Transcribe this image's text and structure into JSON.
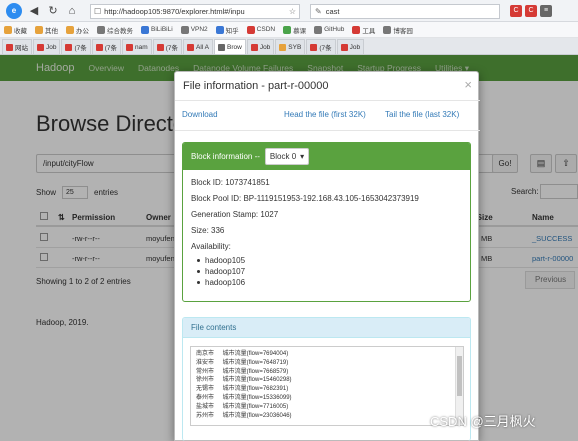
{
  "browser": {
    "url": "http://hadoop105:9870/explorer.html#/inpu",
    "search_query": "cast",
    "bookmarks": [
      "收藏",
      "其他",
      "办公",
      "综合教务",
      "BiLiBiLi",
      "VPN2",
      "知乎",
      "CSDN",
      "慕课",
      "GitHub",
      "工具",
      "博客园"
    ],
    "tabs": [
      "网站",
      "Job",
      "(7条",
      "(7条",
      "nam",
      "(7条",
      "All A",
      "Brow",
      "Job",
      "SYB",
      "(7条",
      "Job"
    ]
  },
  "hadoop": {
    "brand": "Hadoop",
    "nav": [
      "Overview",
      "Datanodes",
      "Datanode Volume Failures",
      "Snapshot",
      "Startup Progress",
      "Utilities ▾"
    ],
    "page_title": "Browse Directory",
    "path": "/input/cityFlow",
    "go": "Go!",
    "show": "Show",
    "page_size": "25",
    "entries": "entries",
    "search_label": "Search:",
    "columns": [
      "Permission",
      "Owner",
      "k Size",
      "Name"
    ],
    "rows": [
      {
        "permission": "-rw-r--r--",
        "owner": "moyufen",
        "size": "MB",
        "name": "_SUCCESS"
      },
      {
        "permission": "-rw-r--r--",
        "owner": "moyufen",
        "size": "MB",
        "name": "part-r-00000"
      }
    ],
    "summary": "Showing 1 to 2 of 2 entries",
    "prev": "Previous",
    "footer": "Hadoop, 2019."
  },
  "modal": {
    "title": "File information - part-r-00000",
    "close": "×",
    "download": "Download",
    "head": "Head the file (first 32K)",
    "tail": "Tail the file (last 32K)",
    "block_info_label": "Block information --",
    "block_select": "Block 0",
    "block_id": "Block ID: 1073741851",
    "block_pool": "Block Pool ID: BP-1119151953-192.168.43.105-1653042373919",
    "generation": "Generation Stamp: 1027",
    "size": "Size: 336",
    "availability": "Availability:",
    "locations": [
      "hadoop105",
      "hadoop107",
      "hadoop106"
    ],
    "file_contents_label": "File contents",
    "file_contents": "南京市\t城市流量(flow=7694004)\n淮安市\t城市流量(flow=7648719)\n常州市\t城市流量(flow=7668579)\n徐州市\t城市流量(flow=15460298)\n无锡市\t城市流量(flow=7682391)\n泰州市\t城市流量(flow=15336099)\n盐城市\t城市流量(flow=7716005)\n苏州市\t城市流量(flow=23036046)"
  },
  "watermark": "CSDN @三月枫火"
}
